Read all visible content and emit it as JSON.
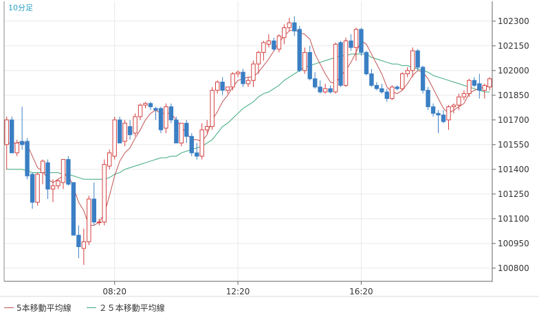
{
  "chart_data": {
    "type": "candlestick",
    "period_label": "10分足",
    "y_ticks": [
      100800,
      100950,
      101100,
      101250,
      101400,
      101550,
      101700,
      101850,
      102000,
      102150,
      102300
    ],
    "x_ticks": [
      "08:20",
      "12:20",
      "16:20"
    ],
    "ylim": [
      100720,
      102420
    ],
    "colors": {
      "up": "#d43c3c",
      "down": "#3a7fc4",
      "ma5": "#c05050",
      "ma25": "#3aa87a",
      "grid": "#e8e8e8"
    },
    "series": [
      {
        "name": "5本移動平均線",
        "color": "#c05050"
      },
      {
        "name": "２５本移動平均線",
        "color": "#3aa87a"
      }
    ],
    "candles": [
      [
        101550,
        101720,
        101400,
        101700
      ],
      [
        101700,
        101720,
        101520,
        101500
      ],
      [
        101500,
        101580,
        101480,
        101560
      ],
      [
        101570,
        101780,
        101520,
        101550
      ],
      [
        101570,
        101590,
        101340,
        101360
      ],
      [
        101370,
        101380,
        101160,
        101200
      ],
      [
        101200,
        101380,
        101180,
        101370
      ],
      [
        101380,
        101460,
        101310,
        101450
      ],
      [
        101440,
        101460,
        101220,
        101280
      ],
      [
        101280,
        101340,
        101200,
        101300
      ],
      [
        101300,
        101340,
        101280,
        101330
      ],
      [
        101320,
        101460,
        101280,
        101460
      ],
      [
        101460,
        101480,
        101300,
        101310
      ],
      [
        101320,
        101320,
        101080,
        101000
      ],
      [
        101000,
        101060,
        100860,
        100930
      ],
      [
        100920,
        101040,
        100820,
        100960
      ],
      [
        100960,
        101240,
        100940,
        101220
      ],
      [
        101220,
        101320,
        101060,
        101080
      ],
      [
        101080,
        101100,
        101060,
        101080
      ],
      [
        101080,
        101460,
        101060,
        101430
      ],
      [
        101420,
        101520,
        101400,
        101500
      ],
      [
        101480,
        101720,
        101460,
        101700
      ],
      [
        101700,
        101720,
        101560,
        101560
      ],
      [
        101570,
        101700,
        101540,
        101680
      ],
      [
        101660,
        101700,
        101580,
        101610
      ],
      [
        101620,
        101740,
        101600,
        101720
      ],
      [
        101720,
        101800,
        101700,
        101790
      ],
      [
        101790,
        101810,
        101770,
        101800
      ],
      [
        101800,
        101810,
        101760,
        101780
      ],
      [
        101770,
        101780,
        101700,
        101760
      ],
      [
        101770,
        101780,
        101620,
        101640
      ],
      [
        101650,
        101800,
        101620,
        101780
      ],
      [
        101780,
        101800,
        101680,
        101700
      ],
      [
        101700,
        101720,
        101560,
        101560
      ],
      [
        101560,
        101680,
        101540,
        101680
      ],
      [
        101680,
        101700,
        101560,
        101600
      ],
      [
        101600,
        101620,
        101480,
        101500
      ],
      [
        101500,
        101560,
        101460,
        101480
      ],
      [
        101480,
        101680,
        101460,
        101640
      ],
      [
        101640,
        101700,
        101620,
        101660
      ],
      [
        101660,
        101900,
        101640,
        101880
      ],
      [
        101880,
        101940,
        101860,
        101930
      ],
      [
        101930,
        101960,
        101850,
        101880
      ],
      [
        101880,
        101900,
        101860,
        101900
      ],
      [
        101900,
        101990,
        101880,
        101980
      ],
      [
        101980,
        102000,
        101960,
        101990
      ],
      [
        101990,
        102010,
        101900,
        101920
      ],
      [
        101920,
        101960,
        101900,
        101940
      ],
      [
        101940,
        102060,
        101900,
        102040
      ],
      [
        102040,
        102120,
        101980,
        102110
      ],
      [
        102110,
        102180,
        102060,
        102170
      ],
      [
        102160,
        102220,
        102140,
        102180
      ],
      [
        102180,
        102200,
        102120,
        102130
      ],
      [
        102130,
        102220,
        102110,
        102210
      ],
      [
        102200,
        102280,
        102160,
        102260
      ],
      [
        102260,
        102320,
        102240,
        102290
      ],
      [
        102290,
        102330,
        102210,
        102240
      ],
      [
        102250,
        102270,
        101990,
        102000
      ],
      [
        102000,
        102140,
        101980,
        102110
      ],
      [
        102110,
        102150,
        101940,
        101950
      ],
      [
        101950,
        101990,
        101890,
        101900
      ],
      [
        101900,
        101940,
        101860,
        101870
      ],
      [
        101870,
        101920,
        101860,
        101890
      ],
      [
        101890,
        101910,
        101860,
        101870
      ],
      [
        101870,
        102170,
        101860,
        102160
      ],
      [
        102170,
        102180,
        101900,
        101910
      ],
      [
        101910,
        102200,
        101900,
        102180
      ],
      [
        102180,
        102220,
        102120,
        102140
      ],
      [
        102140,
        102260,
        102060,
        102250
      ],
      [
        102250,
        102260,
        102090,
        102110
      ],
      [
        102110,
        102120,
        101970,
        101980
      ],
      [
        101980,
        102010,
        101900,
        101910
      ],
      [
        101910,
        101930,
        101880,
        101890
      ],
      [
        101890,
        101920,
        101860,
        101870
      ],
      [
        101870,
        101890,
        101810,
        101830
      ],
      [
        101830,
        101910,
        101820,
        101900
      ],
      [
        101900,
        101910,
        101880,
        101890
      ],
      [
        101890,
        101990,
        101880,
        101980
      ],
      [
        101980,
        102020,
        101960,
        102000
      ],
      [
        102000,
        102140,
        101960,
        102120
      ],
      [
        102120,
        102130,
        102000,
        102020
      ],
      [
        102020,
        102030,
        101860,
        101880
      ],
      [
        101880,
        101900,
        101760,
        101780
      ],
      [
        101780,
        101800,
        101720,
        101740
      ],
      [
        101740,
        101760,
        101620,
        101730
      ],
      [
        101730,
        101760,
        101680,
        101690
      ],
      [
        101700,
        101790,
        101640,
        101780
      ],
      [
        101780,
        101800,
        101740,
        101790
      ],
      [
        101790,
        101860,
        101760,
        101840
      ],
      [
        101840,
        101880,
        101820,
        101860
      ],
      [
        101860,
        101950,
        101840,
        101940
      ],
      [
        101940,
        101960,
        101900,
        101910
      ],
      [
        101920,
        101980,
        101830,
        101880
      ],
      [
        101880,
        101920,
        101830,
        101910
      ],
      [
        101900,
        101960,
        101880,
        101950
      ]
    ],
    "ma5": [
      101560,
      101560,
      101560,
      101570,
      101550,
      101480,
      101410,
      101390,
      101340,
      101320,
      101340,
      101360,
      101370,
      101290,
      101200,
      101150,
      101060,
      101060,
      101080,
      101130,
      101240,
      101360,
      101450,
      101500,
      101530,
      101590,
      101640,
      101700,
      101740,
      101760,
      101740,
      101740,
      101740,
      101700,
      101660,
      101620,
      101580,
      101580,
      101570,
      101610,
      101700,
      101750,
      101810,
      101850,
      101900,
      101940,
      101950,
      101960,
      101960,
      101990,
      102030,
      102070,
      102120,
      102170,
      102210,
      102240,
      102250,
      102230,
      102220,
      102190,
      102100,
      102040,
      101980,
      101930,
      101920,
      101970,
      102000,
      102050,
      102110,
      102180,
      102160,
      102100,
      102040,
      101980,
      101900,
      101870,
      101860,
      101880,
      101920,
      101970,
      102000,
      101990,
      101950,
      101890,
      101830,
      101770,
      101740,
      101760,
      101780,
      101800,
      101860,
      101880,
      101890,
      101900,
      101910
    ],
    "ma25": [
      101400,
      101400,
      101400,
      101400,
      101390,
      101380,
      101380,
      101380,
      101380,
      101380,
      101380,
      101370,
      101370,
      101360,
      101350,
      101340,
      101340,
      101340,
      101340,
      101340,
      101350,
      101370,
      101380,
      101400,
      101410,
      101420,
      101430,
      101440,
      101450,
      101460,
      101470,
      101470,
      101480,
      101480,
      101500,
      101510,
      101520,
      101530,
      101540,
      101560,
      101580,
      101620,
      101660,
      101680,
      101710,
      101740,
      101770,
      101790,
      101810,
      101840,
      101860,
      101870,
      101890,
      101910,
      101940,
      101960,
      101980,
      102000,
      102020,
      102030,
      102040,
      102050,
      102060,
      102070,
      102080,
      102090,
      102090,
      102100,
      102100,
      102100,
      102100,
      102080,
      102070,
      102060,
      102050,
      102040,
      102040,
      102030,
      102030,
      102020,
      102010,
      102000,
      101990,
      101970,
      101960,
      101950,
      101940,
      101930,
      101920,
      101910,
      101900,
      101890,
      101880,
      101870,
      101870
    ]
  }
}
